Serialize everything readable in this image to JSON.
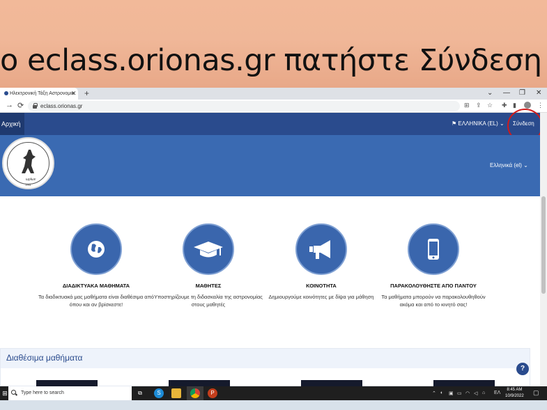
{
  "slide": {
    "title": "o eclass.orionas.gr πατήστε Σύνδεση"
  },
  "browser": {
    "tab_title": "Ηλεκτρονική Τάξη Αστρονομικ",
    "tab_close": "✕",
    "new_tab": "+",
    "url": "eclass.orionas.gr",
    "window_controls": [
      "⌄",
      "—",
      "❐",
      "✕"
    ]
  },
  "site": {
    "nav_home": "Αρχική",
    "lang_top": "ΕΛΛΗΝΙΚΑ (EL)",
    "login": "Σύνδεση",
    "lang_banner": "Ελληνικά (el)",
    "logo_text": "ωρίων",
    "logo_year": "1961"
  },
  "features": [
    {
      "title": "ΔΙΑΔΙΚΤΥΑΚΑ ΜΑΘΗΜΑΤΑ",
      "desc": "Τα διαδικτυακά μας μαθήματα είναι διαθέσιμα από όπου και αν βρίσκεστε!",
      "icon": "globe-icon"
    },
    {
      "title": "ΜΑΘΗΤΕΣ",
      "desc": "Υποστηρίζουμε τη διδασκαλία της αστρονομίας στους μαθητές",
      "icon": "graduation-cap-icon"
    },
    {
      "title": "ΚΟΙΝΟΤΗΤΑ",
      "desc": "Δημιουργούμε κοινότητες με δίψα για μάθηση",
      "icon": "megaphone-icon"
    },
    {
      "title": "ΠΑΡΑΚΟΛΟΥΘΗΣΤΕ ΑΠΟ ΠΑΝΤΟΥ",
      "desc": "Τα μαθήματα μπορούν να παρακολουθηθούν ακόμα και από το κινητό σας!",
      "icon": "mobile-phone-icon"
    }
  ],
  "courses": {
    "heading": "Διαθέσιμα μαθήματα"
  },
  "help": "?",
  "taskbar": {
    "search_placeholder": "Type here to search",
    "language": "ΕΛ",
    "time": "8:45 AM",
    "date": "10/9/2022"
  },
  "colors": {
    "nav": "#2a4b8d",
    "banner": "#3a6ab2",
    "feature_circle": "#3a66ad",
    "annotation": "#d11a1a"
  }
}
